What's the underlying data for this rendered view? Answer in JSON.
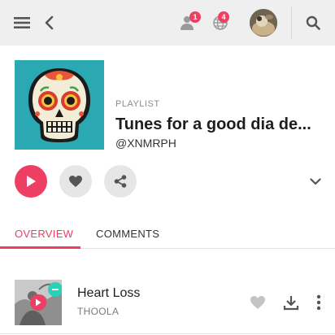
{
  "header": {
    "notifications_badge": "1",
    "friends_badge": "4",
    "icons": [
      "menu-icon",
      "back-arrow-icon",
      "people-icon",
      "globe-icon",
      "search-icon"
    ]
  },
  "playlist": {
    "type_label": "PLAYLIST",
    "title": "Tunes for a good dia de...",
    "owner": "@XNMRPH"
  },
  "tabs": [
    {
      "label": "OVERVIEW",
      "active": true
    },
    {
      "label": "COMMENTS",
      "active": false
    }
  ],
  "tracks": [
    {
      "title": "Heart Loss",
      "artist": "THOOLA"
    }
  ],
  "colors": {
    "accent": "#ef3e64",
    "topbar_bg": "#efefef",
    "cover_bg": "#2ba9b3",
    "icon_gray": "#555555"
  }
}
